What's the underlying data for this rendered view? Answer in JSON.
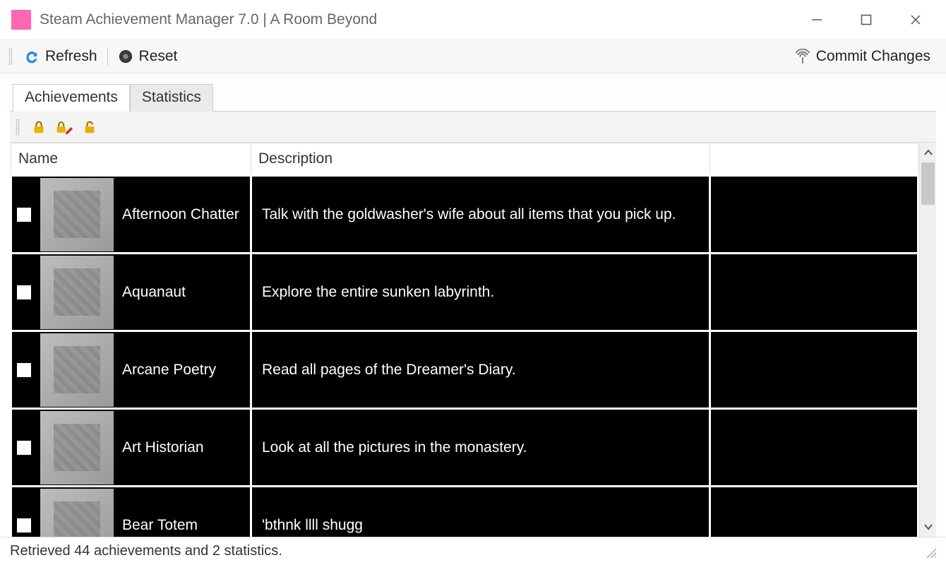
{
  "window": {
    "title": "Steam Achievement Manager 7.0 | A Room Beyond"
  },
  "toolbar": {
    "refresh_label": "Refresh",
    "reset_label": "Reset",
    "commit_label": "Commit Changes"
  },
  "tabs": {
    "achievements_label": "Achievements",
    "statistics_label": "Statistics",
    "active_index": 0
  },
  "table": {
    "columns": {
      "name": "Name",
      "description": "Description"
    },
    "rows": [
      {
        "checked": false,
        "name": "Afternoon Chatter",
        "description": "Talk with the goldwasher's wife about all items that you pick up."
      },
      {
        "checked": false,
        "name": "Aquanaut",
        "description": "Explore the entire sunken labyrinth."
      },
      {
        "checked": false,
        "name": "Arcane Poetry",
        "description": "Read all pages of the Dreamer's Diary."
      },
      {
        "checked": false,
        "name": "Art Historian",
        "description": " Look at all the pictures in the monastery."
      },
      {
        "checked": false,
        "name": "Bear Totem",
        "description": "'bthnk llll shugg"
      }
    ]
  },
  "status": {
    "text": "Retrieved 44 achievements and 2 statistics."
  },
  "icons": {
    "refresh": "refresh-icon",
    "reset": "reset-icon",
    "commit": "broadcast-icon",
    "lock": "lock-icon",
    "lock_edit": "lock-edit-icon",
    "unlock": "unlock-icon"
  }
}
